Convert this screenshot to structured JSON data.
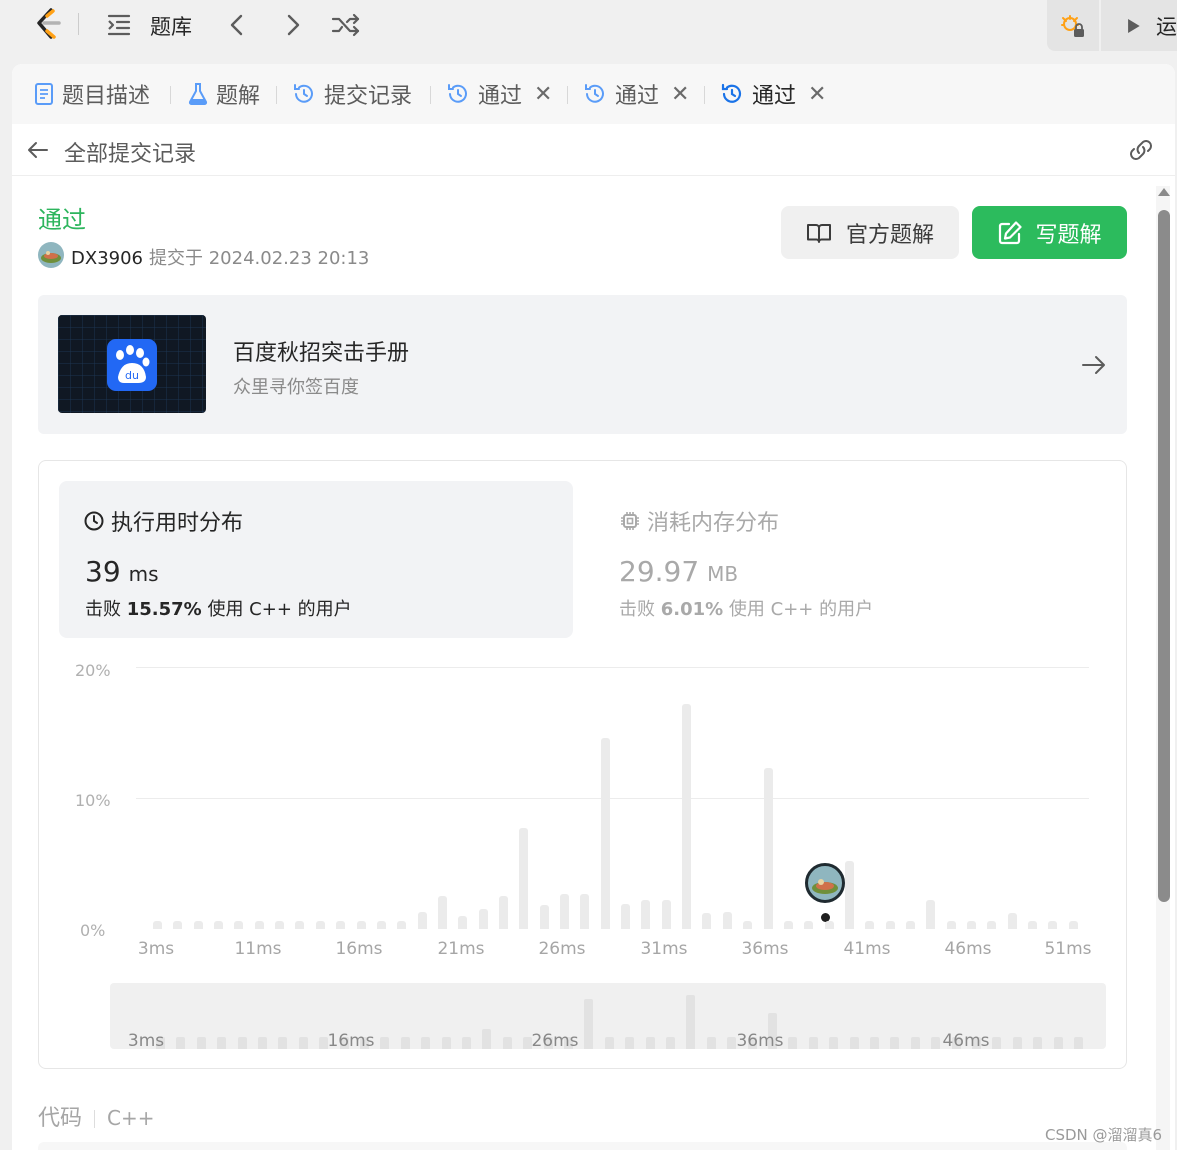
{
  "nav": {
    "title": "题库",
    "right_run_label": "运"
  },
  "tabs": [
    {
      "label": "题目描述",
      "icon": "document-icon"
    },
    {
      "label": "题解",
      "icon": "flask-icon"
    },
    {
      "label": "提交记录",
      "icon": "history-icon"
    },
    {
      "label": "通过",
      "icon": "history-icon",
      "closable": true
    },
    {
      "label": "通过",
      "icon": "history-icon",
      "closable": true
    },
    {
      "label": "通过",
      "icon": "history-icon",
      "closable": true,
      "active": true
    }
  ],
  "close_glyph": "✕",
  "subheader": {
    "title": "全部提交记录"
  },
  "submission": {
    "status": "通过",
    "status_color": "#2db55d",
    "user": "DX3906",
    "submitted_text": "提交于 2024.02.23 20:13"
  },
  "buttons": {
    "official": "官方题解",
    "write": "写题解",
    "write_color": "#2cbb5d"
  },
  "promo": {
    "title": "百度秋招突击手册",
    "subtitle": "众里寻你签百度"
  },
  "runtime": {
    "heading": "执行用时分布",
    "value": "39",
    "unit": "ms",
    "beat_prefix": "击败",
    "beat_pct": "15.57%",
    "beat_suffix": "使用 C++ 的用户"
  },
  "memory": {
    "heading": "消耗内存分布",
    "value": "29.97",
    "unit": "MB",
    "beat_prefix": "击败",
    "beat_pct": "6.01%",
    "beat_suffix": "使用 C++ 的用户"
  },
  "chart_data": {
    "type": "bar",
    "y_ticks": [
      "20%",
      "10%",
      "0%"
    ],
    "ylim": [
      0,
      20
    ],
    "x_tick_labels": [
      "3ms",
      "11ms",
      "16ms",
      "21ms",
      "26ms",
      "31ms",
      "36ms",
      "41ms",
      "46ms",
      "51ms"
    ],
    "values": [
      0.6,
      0.6,
      0.6,
      0.6,
      0.6,
      0.6,
      0.6,
      0.6,
      0.6,
      0.6,
      0.6,
      0.6,
      0.6,
      1.3,
      2.5,
      1.0,
      1.5,
      2.5,
      7.7,
      1.8,
      2.7,
      2.7,
      14.6,
      1.9,
      2.2,
      2.2,
      17.2,
      1.2,
      1.3,
      0.6,
      12.3,
      0.6,
      0.6,
      0.6,
      5.2,
      0.6,
      0.6,
      0.6,
      2.2,
      0.6,
      0.6,
      0.6,
      1.2,
      0.6,
      0.6,
      0.6
    ],
    "highlight_index": 33
  },
  "mini_chart": {
    "labels": [
      "3ms",
      "16ms",
      "26ms",
      "36ms",
      "46ms"
    ],
    "values": [
      0.6,
      0.6,
      0.6,
      0.6,
      0.6,
      0.6,
      0.6,
      0.6,
      0.6,
      0.6,
      0.6,
      0.6,
      0.6,
      0.6,
      0.6,
      0.6,
      1.0,
      0.6,
      0.6,
      0.6,
      0.6,
      2.5,
      0.6,
      0.6,
      0.6,
      0.6,
      2.7,
      0.6,
      0.6,
      0.6,
      1.8,
      0.6,
      0.6,
      0.6,
      0.6,
      0.6,
      0.6,
      0.6,
      0.6,
      0.6,
      0.6,
      0.6,
      0.6,
      0.6,
      0.6,
      0.6
    ]
  },
  "code": {
    "label": "代码",
    "lang": "C++"
  },
  "watermark": "CSDN @溜溜真6"
}
